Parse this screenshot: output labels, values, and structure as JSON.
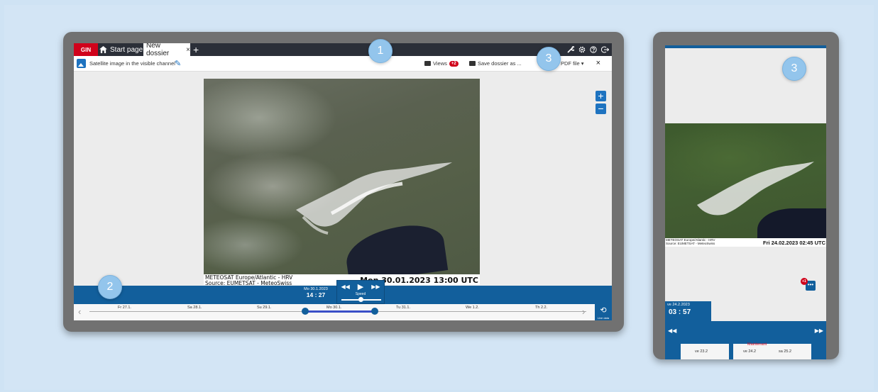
{
  "callouts": [
    "1",
    "2",
    "3",
    "3"
  ],
  "main": {
    "tabbar": {
      "logo": "GIN",
      "tabs": [
        {
          "label": "Start page",
          "icon": "home-icon"
        },
        {
          "label": "New dossier",
          "close": "×"
        }
      ],
      "add_tab": "+",
      "icons": [
        "wrench-icon",
        "gear-icon",
        "help-icon",
        "logout-icon"
      ]
    },
    "toolbar": {
      "layer_title": "Satellite image in the visible channel",
      "views_label": "Views",
      "views_badge": "+2",
      "save_label": "Save dossier as ...",
      "pdf_label": "PDF file ▾",
      "close": "×"
    },
    "map": {
      "caption_line1": "METEOSAT Europe/Atlantic - HRV",
      "caption_line2": "Source: EUMETSAT - MeteoSwiss",
      "caption_date": "Mon 30.01.2023 13:00 UTC",
      "zoom_in": "+",
      "zoom_out": "−"
    },
    "time": {
      "date": "Mo 30.1.2023",
      "clock": "14 : 27",
      "player": {
        "rewind": "◀◀",
        "play": "▶",
        "forward": "▶▶",
        "speed_label": "Speed"
      },
      "days": [
        "Fr 27.1.",
        "Sa 28.1.",
        "Su 29.1.",
        "Mo 30.1.",
        "Tu 31.1.",
        "We 1.2.",
        "Th 2.2."
      ],
      "live_label": "Live data"
    }
  },
  "side": {
    "caption_small_line1": "METEOSAT Europe/Atlantic - HRV",
    "caption_small_line2": "Source: EUMETSAT - MeteoSwiss",
    "caption_date": "Fri 24.02.2023 02:45 UTC",
    "fab_badge": "+1",
    "fab_label": "•••",
    "time_date": "ve 24.2.2023",
    "time_clock": "03 : 57",
    "rewind": "◀◀",
    "forward": "▶▶",
    "now_label": "Maintenant",
    "timeline_labels": [
      "ve 23.2",
      "ve 24.2",
      "sa 25.2"
    ]
  }
}
